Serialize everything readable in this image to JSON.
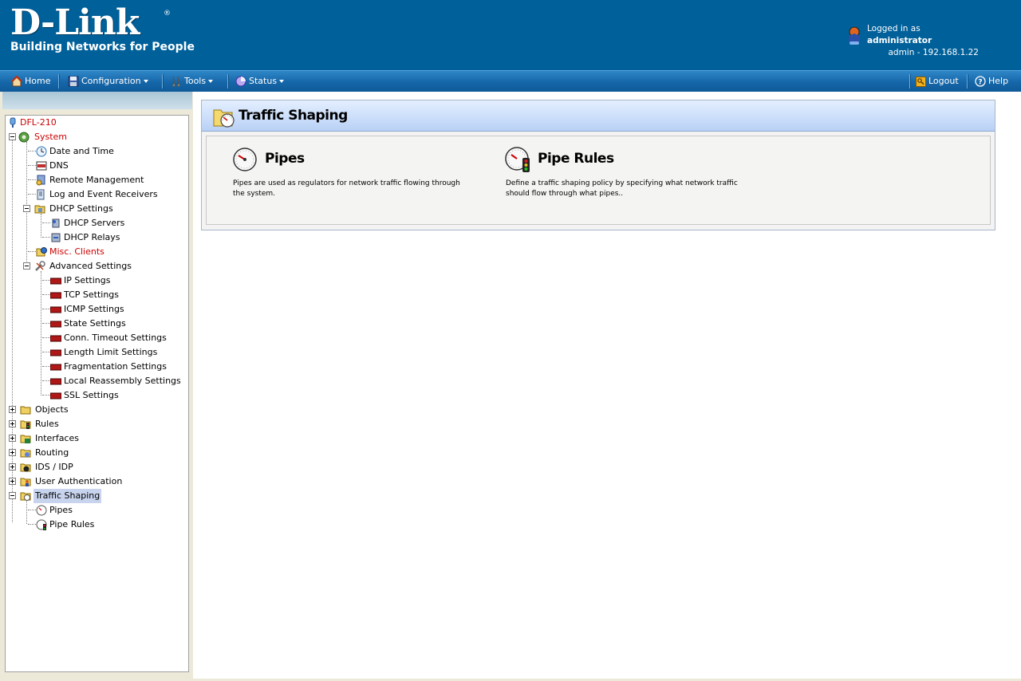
{
  "header": {
    "brand": "D-Link",
    "tagline": "Building Networks for People",
    "login_prefix": "Logged in as",
    "login_user": "administrator",
    "login_detail": "admin - 192.168.1.22"
  },
  "menu": {
    "home": "Home",
    "configuration": "Configuration",
    "tools": "Tools",
    "status": "Status",
    "logout": "Logout",
    "help": "Help"
  },
  "tree": {
    "root": "DFL-210",
    "system": "System",
    "date_time": "Date and Time",
    "dns": "DNS",
    "remote_mgmt": "Remote Management",
    "log_receivers": "Log and Event Receivers",
    "dhcp_settings": "DHCP Settings",
    "dhcp_servers": "DHCP Servers",
    "dhcp_relays": "DHCP Relays",
    "misc_clients": "Misc. Clients",
    "advanced_settings": "Advanced Settings",
    "ip_settings": "IP Settings",
    "tcp_settings": "TCP Settings",
    "icmp_settings": "ICMP Settings",
    "state_settings": "State Settings",
    "conn_timeout": "Conn. Timeout Settings",
    "length_limit": "Length Limit Settings",
    "fragmentation": "Fragmentation Settings",
    "local_reassembly": "Local Reassembly Settings",
    "ssl_settings": "SSL Settings",
    "objects": "Objects",
    "rules": "Rules",
    "interfaces": "Interfaces",
    "routing": "Routing",
    "ids_idp": "IDS / IDP",
    "user_auth": "User Authentication",
    "traffic_shaping": "Traffic Shaping",
    "pipes": "Pipes",
    "pipe_rules": "Pipe Rules"
  },
  "content": {
    "title": "Traffic Shaping",
    "pipes_title": "Pipes",
    "pipes_desc": "Pipes are used as regulators for network traffic flowing through the system.",
    "pipe_rules_title": "Pipe Rules",
    "pipe_rules_desc": "Define a traffic shaping policy by specifying what network traffic should flow through what pipes.."
  },
  "colors": {
    "header_bg": "#00609a",
    "menubar": "#1566a8",
    "selected_red": "#cc0000"
  }
}
